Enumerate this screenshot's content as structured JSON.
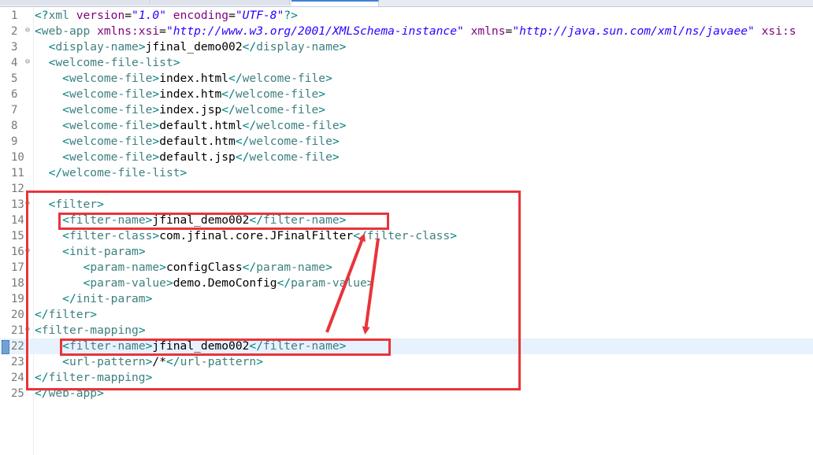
{
  "tabs": [
    {
      "label": ""
    },
    {
      "label": ""
    },
    {
      "label": ""
    }
  ],
  "editor": {
    "current_line": 22,
    "lines": [
      {
        "num": "1",
        "code": [
          [
            "pi",
            "<?"
          ],
          [
            "tag",
            "xml "
          ],
          [
            "attr",
            "version"
          ],
          [
            "txt",
            "="
          ],
          [
            "val",
            "\"1.0\""
          ],
          [
            "txt",
            " "
          ],
          [
            "attr",
            "encoding"
          ],
          [
            "txt",
            "="
          ],
          [
            "val",
            "\"UTF-8\""
          ],
          [
            "pi",
            "?>"
          ]
        ]
      },
      {
        "num": "2",
        "fold": true,
        "code": [
          [
            "br",
            "<"
          ],
          [
            "tag",
            "web-app "
          ],
          [
            "attr",
            "xmlns:xsi"
          ],
          [
            "txt",
            "="
          ],
          [
            "val",
            "\"http://www.w3.org/2001/XMLSchema-instance\""
          ],
          [
            "txt",
            " "
          ],
          [
            "attr",
            "xmlns"
          ],
          [
            "txt",
            "="
          ],
          [
            "val",
            "\"http://java.sun.com/xml/ns/javaee\""
          ],
          [
            "txt",
            " "
          ],
          [
            "attr",
            "xsi:s"
          ]
        ]
      },
      {
        "num": "3",
        "code": [
          [
            "txt",
            "  "
          ],
          [
            "br",
            "<"
          ],
          [
            "tag",
            "display-name"
          ],
          [
            "br",
            ">"
          ],
          [
            "txt",
            "jfinal_demo002"
          ],
          [
            "br",
            "</"
          ],
          [
            "tag",
            "display-name"
          ],
          [
            "br",
            ">"
          ]
        ]
      },
      {
        "num": "4",
        "fold": true,
        "code": [
          [
            "txt",
            "  "
          ],
          [
            "br",
            "<"
          ],
          [
            "tag",
            "welcome-file-list"
          ],
          [
            "br",
            ">"
          ]
        ]
      },
      {
        "num": "5",
        "code": [
          [
            "txt",
            "    "
          ],
          [
            "br",
            "<"
          ],
          [
            "tag",
            "welcome-file"
          ],
          [
            "br",
            ">"
          ],
          [
            "txt",
            "index.html"
          ],
          [
            "br",
            "</"
          ],
          [
            "tag",
            "welcome-file"
          ],
          [
            "br",
            ">"
          ]
        ]
      },
      {
        "num": "6",
        "code": [
          [
            "txt",
            "    "
          ],
          [
            "br",
            "<"
          ],
          [
            "tag",
            "welcome-file"
          ],
          [
            "br",
            ">"
          ],
          [
            "txt",
            "index.htm"
          ],
          [
            "br",
            "</"
          ],
          [
            "tag",
            "welcome-file"
          ],
          [
            "br",
            ">"
          ]
        ]
      },
      {
        "num": "7",
        "code": [
          [
            "txt",
            "    "
          ],
          [
            "br",
            "<"
          ],
          [
            "tag",
            "welcome-file"
          ],
          [
            "br",
            ">"
          ],
          [
            "txt",
            "index.jsp"
          ],
          [
            "br",
            "</"
          ],
          [
            "tag",
            "welcome-file"
          ],
          [
            "br",
            ">"
          ]
        ]
      },
      {
        "num": "8",
        "code": [
          [
            "txt",
            "    "
          ],
          [
            "br",
            "<"
          ],
          [
            "tag",
            "welcome-file"
          ],
          [
            "br",
            ">"
          ],
          [
            "txt",
            "default.html"
          ],
          [
            "br",
            "</"
          ],
          [
            "tag",
            "welcome-file"
          ],
          [
            "br",
            ">"
          ]
        ]
      },
      {
        "num": "9",
        "code": [
          [
            "txt",
            "    "
          ],
          [
            "br",
            "<"
          ],
          [
            "tag",
            "welcome-file"
          ],
          [
            "br",
            ">"
          ],
          [
            "txt",
            "default.htm"
          ],
          [
            "br",
            "</"
          ],
          [
            "tag",
            "welcome-file"
          ],
          [
            "br",
            ">"
          ]
        ]
      },
      {
        "num": "10",
        "code": [
          [
            "txt",
            "    "
          ],
          [
            "br",
            "<"
          ],
          [
            "tag",
            "welcome-file"
          ],
          [
            "br",
            ">"
          ],
          [
            "txt",
            "default.jsp"
          ],
          [
            "br",
            "</"
          ],
          [
            "tag",
            "welcome-file"
          ],
          [
            "br",
            ">"
          ]
        ]
      },
      {
        "num": "11",
        "code": [
          [
            "txt",
            "  "
          ],
          [
            "br",
            "</"
          ],
          [
            "tag",
            "welcome-file-list"
          ],
          [
            "br",
            ">"
          ]
        ]
      },
      {
        "num": "12",
        "code": []
      },
      {
        "num": "13",
        "fold": true,
        "code": [
          [
            "txt",
            "  "
          ],
          [
            "br",
            "<"
          ],
          [
            "tag",
            "filter"
          ],
          [
            "br",
            ">"
          ]
        ]
      },
      {
        "num": "14",
        "code": [
          [
            "txt",
            "    "
          ],
          [
            "br",
            "<"
          ],
          [
            "tag",
            "filter-name"
          ],
          [
            "br",
            ">"
          ],
          [
            "txt",
            "jfinal_demo002"
          ],
          [
            "br",
            "</"
          ],
          [
            "tag",
            "filter-name"
          ],
          [
            "br",
            ">"
          ]
        ]
      },
      {
        "num": "15",
        "code": [
          [
            "txt",
            "    "
          ],
          [
            "br",
            "<"
          ],
          [
            "tag",
            "filter-class"
          ],
          [
            "br",
            ">"
          ],
          [
            "txt",
            "com.jfinal.core.JFinalFilter"
          ],
          [
            "br",
            "</"
          ],
          [
            "tag",
            "filter-class"
          ],
          [
            "br",
            ">"
          ]
        ]
      },
      {
        "num": "16",
        "fold": true,
        "code": [
          [
            "txt",
            "    "
          ],
          [
            "br",
            "<"
          ],
          [
            "tag",
            "init-param"
          ],
          [
            "br",
            ">"
          ]
        ]
      },
      {
        "num": "17",
        "code": [
          [
            "txt",
            "       "
          ],
          [
            "br",
            "<"
          ],
          [
            "tag",
            "param-name"
          ],
          [
            "br",
            ">"
          ],
          [
            "txt",
            "configClass"
          ],
          [
            "br",
            "</"
          ],
          [
            "tag",
            "param-name"
          ],
          [
            "br",
            ">"
          ]
        ]
      },
      {
        "num": "18",
        "code": [
          [
            "txt",
            "       "
          ],
          [
            "br",
            "<"
          ],
          [
            "tag",
            "param-value"
          ],
          [
            "br",
            ">"
          ],
          [
            "txt",
            "demo.DemoConfig"
          ],
          [
            "br",
            "</"
          ],
          [
            "tag",
            "param-value"
          ],
          [
            "br",
            ">"
          ]
        ]
      },
      {
        "num": "19",
        "code": [
          [
            "txt",
            "    "
          ],
          [
            "br",
            "</"
          ],
          [
            "tag",
            "init-param"
          ],
          [
            "br",
            ">"
          ]
        ]
      },
      {
        "num": "20",
        "code": [
          [
            "br",
            "</"
          ],
          [
            "tag",
            "filter"
          ],
          [
            "br",
            ">"
          ]
        ]
      },
      {
        "num": "21",
        "fold": true,
        "code": [
          [
            "br",
            "<"
          ],
          [
            "tag",
            "filter-mapping"
          ],
          [
            "br",
            ">"
          ]
        ]
      },
      {
        "num": "22",
        "code": [
          [
            "txt",
            "    "
          ],
          [
            "br",
            "<"
          ],
          [
            "tag",
            "filter-name"
          ],
          [
            "br",
            ">"
          ],
          [
            "txt",
            "jfinal_demo002"
          ],
          [
            "br",
            "</"
          ],
          [
            "tag",
            "filter-name"
          ],
          [
            "br",
            ">"
          ]
        ]
      },
      {
        "num": "23",
        "code": [
          [
            "txt",
            "    "
          ],
          [
            "br",
            "<"
          ],
          [
            "tag",
            "url-pattern"
          ],
          [
            "br",
            ">"
          ],
          [
            "txt",
            "/*"
          ],
          [
            "br",
            "</"
          ],
          [
            "tag",
            "url-pattern"
          ],
          [
            "br",
            ">"
          ]
        ]
      },
      {
        "num": "24",
        "code": [
          [
            "br",
            "</"
          ],
          [
            "tag",
            "filter-mapping"
          ],
          [
            "br",
            ">"
          ]
        ]
      },
      {
        "num": "25",
        "code": [
          [
            "br",
            "</"
          ],
          [
            "tag",
            "web-app"
          ],
          [
            "br",
            ">"
          ]
        ]
      }
    ]
  },
  "colors": {
    "annotation": "#e8343a",
    "current_line": "#e8f2fe"
  }
}
